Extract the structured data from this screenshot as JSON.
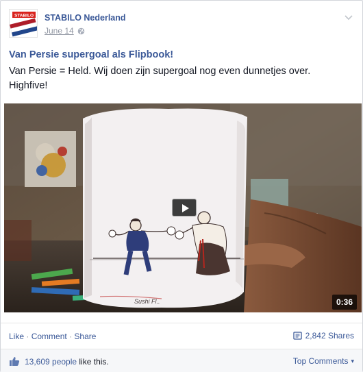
{
  "post": {
    "page_name": "STABILO Nederland",
    "date": "June 14",
    "avatar_logo_text": "STABILO",
    "title": "Van Persie supergoal als Flipbook!",
    "description": "Van Persie = Held. Wij doen zijn supergoal nog even dunnetjes over. Highfive!"
  },
  "video": {
    "duration": "0:36"
  },
  "actions": {
    "like": "Like",
    "comment": "Comment",
    "share": "Share",
    "separator": "·",
    "shares_count": "2,842 Shares"
  },
  "likes_bar": {
    "likes_count": "13,609 people",
    "likes_suffix": "like this.",
    "top_comments": "Top Comments",
    "top_comments_arrow": "▾"
  },
  "colors": {
    "link_blue": "#3b5998",
    "meta_gray": "#9197a3"
  }
}
